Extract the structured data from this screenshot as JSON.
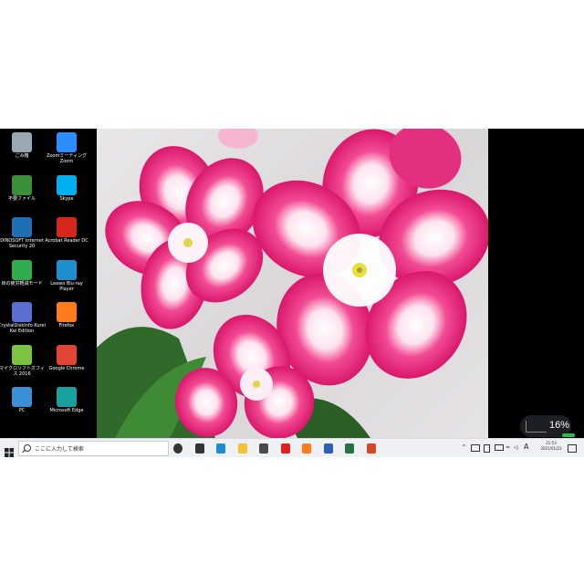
{
  "desktop": {
    "icons": [
      {
        "label": "ごみ箱",
        "icon": "recycle-bin-icon",
        "color": "#9aa8b5"
      },
      {
        "label": "Zoomミーティング Zoom",
        "icon": "zoom-icon",
        "color": "#2d8cff"
      },
      {
        "label": "不要ファイル",
        "icon": "cleaner-icon",
        "color": "#3a8f3a"
      },
      {
        "label": "Skype",
        "icon": "skype-icon",
        "color": "#00aff0"
      },
      {
        "label": "DINOSOFT Internet Security 20",
        "icon": "security-icon",
        "color": "#1f6fb5"
      },
      {
        "label": "Acrobat Reader DC",
        "icon": "acrobat-icon",
        "color": "#d7261e"
      },
      {
        "label": "目の疲労軽減モード",
        "icon": "eye-care-icon",
        "color": "#2eae4f"
      },
      {
        "label": "Leawo Blu-ray Player",
        "icon": "bluray-player-icon",
        "color": "#1e90d0"
      },
      {
        "label": "CrystalDiskInfo Kurei Kei Edition",
        "icon": "crystaldiskinfo-icon",
        "color": "#5a6fd1"
      },
      {
        "label": "Firefox",
        "icon": "firefox-icon",
        "color": "#ff7a1a"
      },
      {
        "label": "マイクロソフトオフィス 2016",
        "icon": "office-icon",
        "color": "#7cc341"
      },
      {
        "label": "Google Chrome",
        "icon": "chrome-icon",
        "color": "#e04535"
      },
      {
        "label": "PC",
        "icon": "this-pc-icon",
        "color": "#3b8fd6"
      },
      {
        "label": "Microsoft Edge",
        "icon": "edge-icon",
        "color": "#1ba0a0"
      }
    ]
  },
  "taskbar": {
    "search_placeholder": "ここに入力して検索",
    "pinned": [
      {
        "icon": "cortana-icon",
        "color": "#333333"
      },
      {
        "icon": "task-view-icon",
        "color": "#333333"
      },
      {
        "icon": "edge-icon",
        "color": "#1b8fd6"
      },
      {
        "icon": "file-explorer-icon",
        "color": "#f2c233"
      },
      {
        "icon": "mail-icon",
        "color": "#4a4a4a"
      },
      {
        "icon": "youtube-icon",
        "color": "#e02020"
      },
      {
        "icon": "firefox-icon",
        "color": "#ff7a1a"
      },
      {
        "icon": "word-icon",
        "color": "#2b5fb8"
      },
      {
        "icon": "excel-icon",
        "color": "#217346"
      },
      {
        "icon": "powerpoint-icon",
        "color": "#d24726"
      }
    ],
    "tray": {
      "ime": "A",
      "time": "21:53",
      "date": "2021/01/23"
    },
    "widget_value": "16%"
  },
  "accent_color": "#e81f72"
}
